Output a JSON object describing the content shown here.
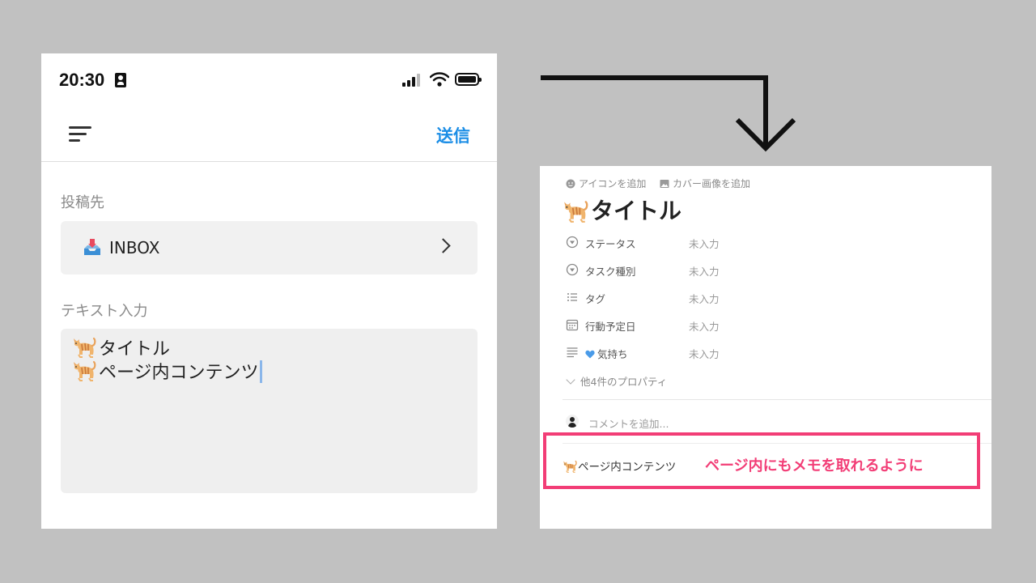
{
  "colors": {
    "accent": "#1a8de6",
    "highlight": "#f23d76",
    "panel_bg": "#c1c1c1"
  },
  "phone": {
    "status_bar": {
      "time": "20:30"
    },
    "header": {
      "menu_icon": "menu-lines-icon",
      "send_label": "送信"
    },
    "destination": {
      "label": "投稿先",
      "value": "INBOX",
      "icon": "inbox-tray-icon"
    },
    "text_input": {
      "label": "テキスト入力",
      "lines": [
        "タイトル",
        "ページ内コンテンツ"
      ]
    }
  },
  "notion_page": {
    "actions": {
      "add_icon": "アイコンを追加",
      "add_cover": "カバー画像を追加"
    },
    "title": "タイトル",
    "properties": [
      {
        "icon": "select-circle-icon",
        "name": "ステータス",
        "value": "未入力"
      },
      {
        "icon": "select-circle-icon",
        "name": "タスク種別",
        "value": "未入力"
      },
      {
        "icon": "list-icon",
        "name": "タグ",
        "value": "未入力"
      },
      {
        "icon": "calendar-icon",
        "name": "行動予定日",
        "value": "未入力"
      },
      {
        "icon": "text-lines-icon",
        "name": "気持ち",
        "name_prefix_icon": "blue-heart-icon",
        "value": "未入力"
      }
    ],
    "more_properties": "他4件のプロパティ",
    "comment_placeholder": "コメントを追加...",
    "body": "ページ内コンテンツ"
  },
  "annotation": {
    "text": "ページ内にもメモを取れるように"
  }
}
